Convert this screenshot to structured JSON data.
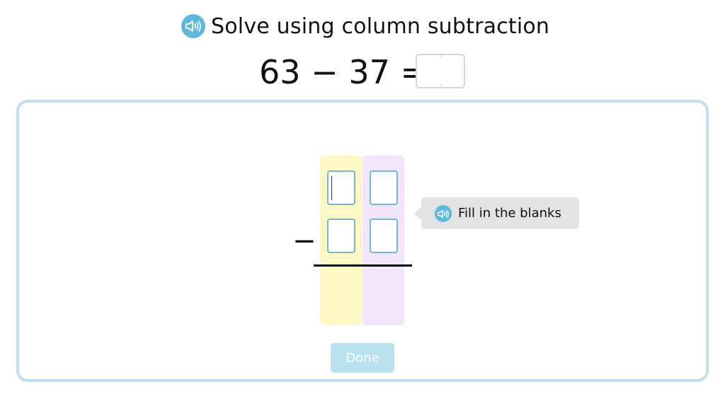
{
  "header": {
    "title": "Solve using column subtraction",
    "speaker_icon": "speaker-icon"
  },
  "equation": {
    "text": "63 − 37 =",
    "answer_value": ""
  },
  "workspace": {
    "operator": "−",
    "columns": [
      {
        "name": "tens",
        "color": "#fdf8c6"
      },
      {
        "name": "ones",
        "color": "#f3e6fc"
      }
    ],
    "inputs": {
      "top_tens": "",
      "top_ones": "",
      "bottom_tens": "",
      "bottom_ones": ""
    }
  },
  "hint": {
    "text": "Fill in the blanks",
    "speaker_icon": "speaker-icon"
  },
  "actions": {
    "done_label": "Done"
  },
  "colors": {
    "accent": "#5cb8dc",
    "panel_border": "#bde0ec",
    "input_border": "#6fb7d3",
    "done_disabled": "#b9e2ee"
  }
}
